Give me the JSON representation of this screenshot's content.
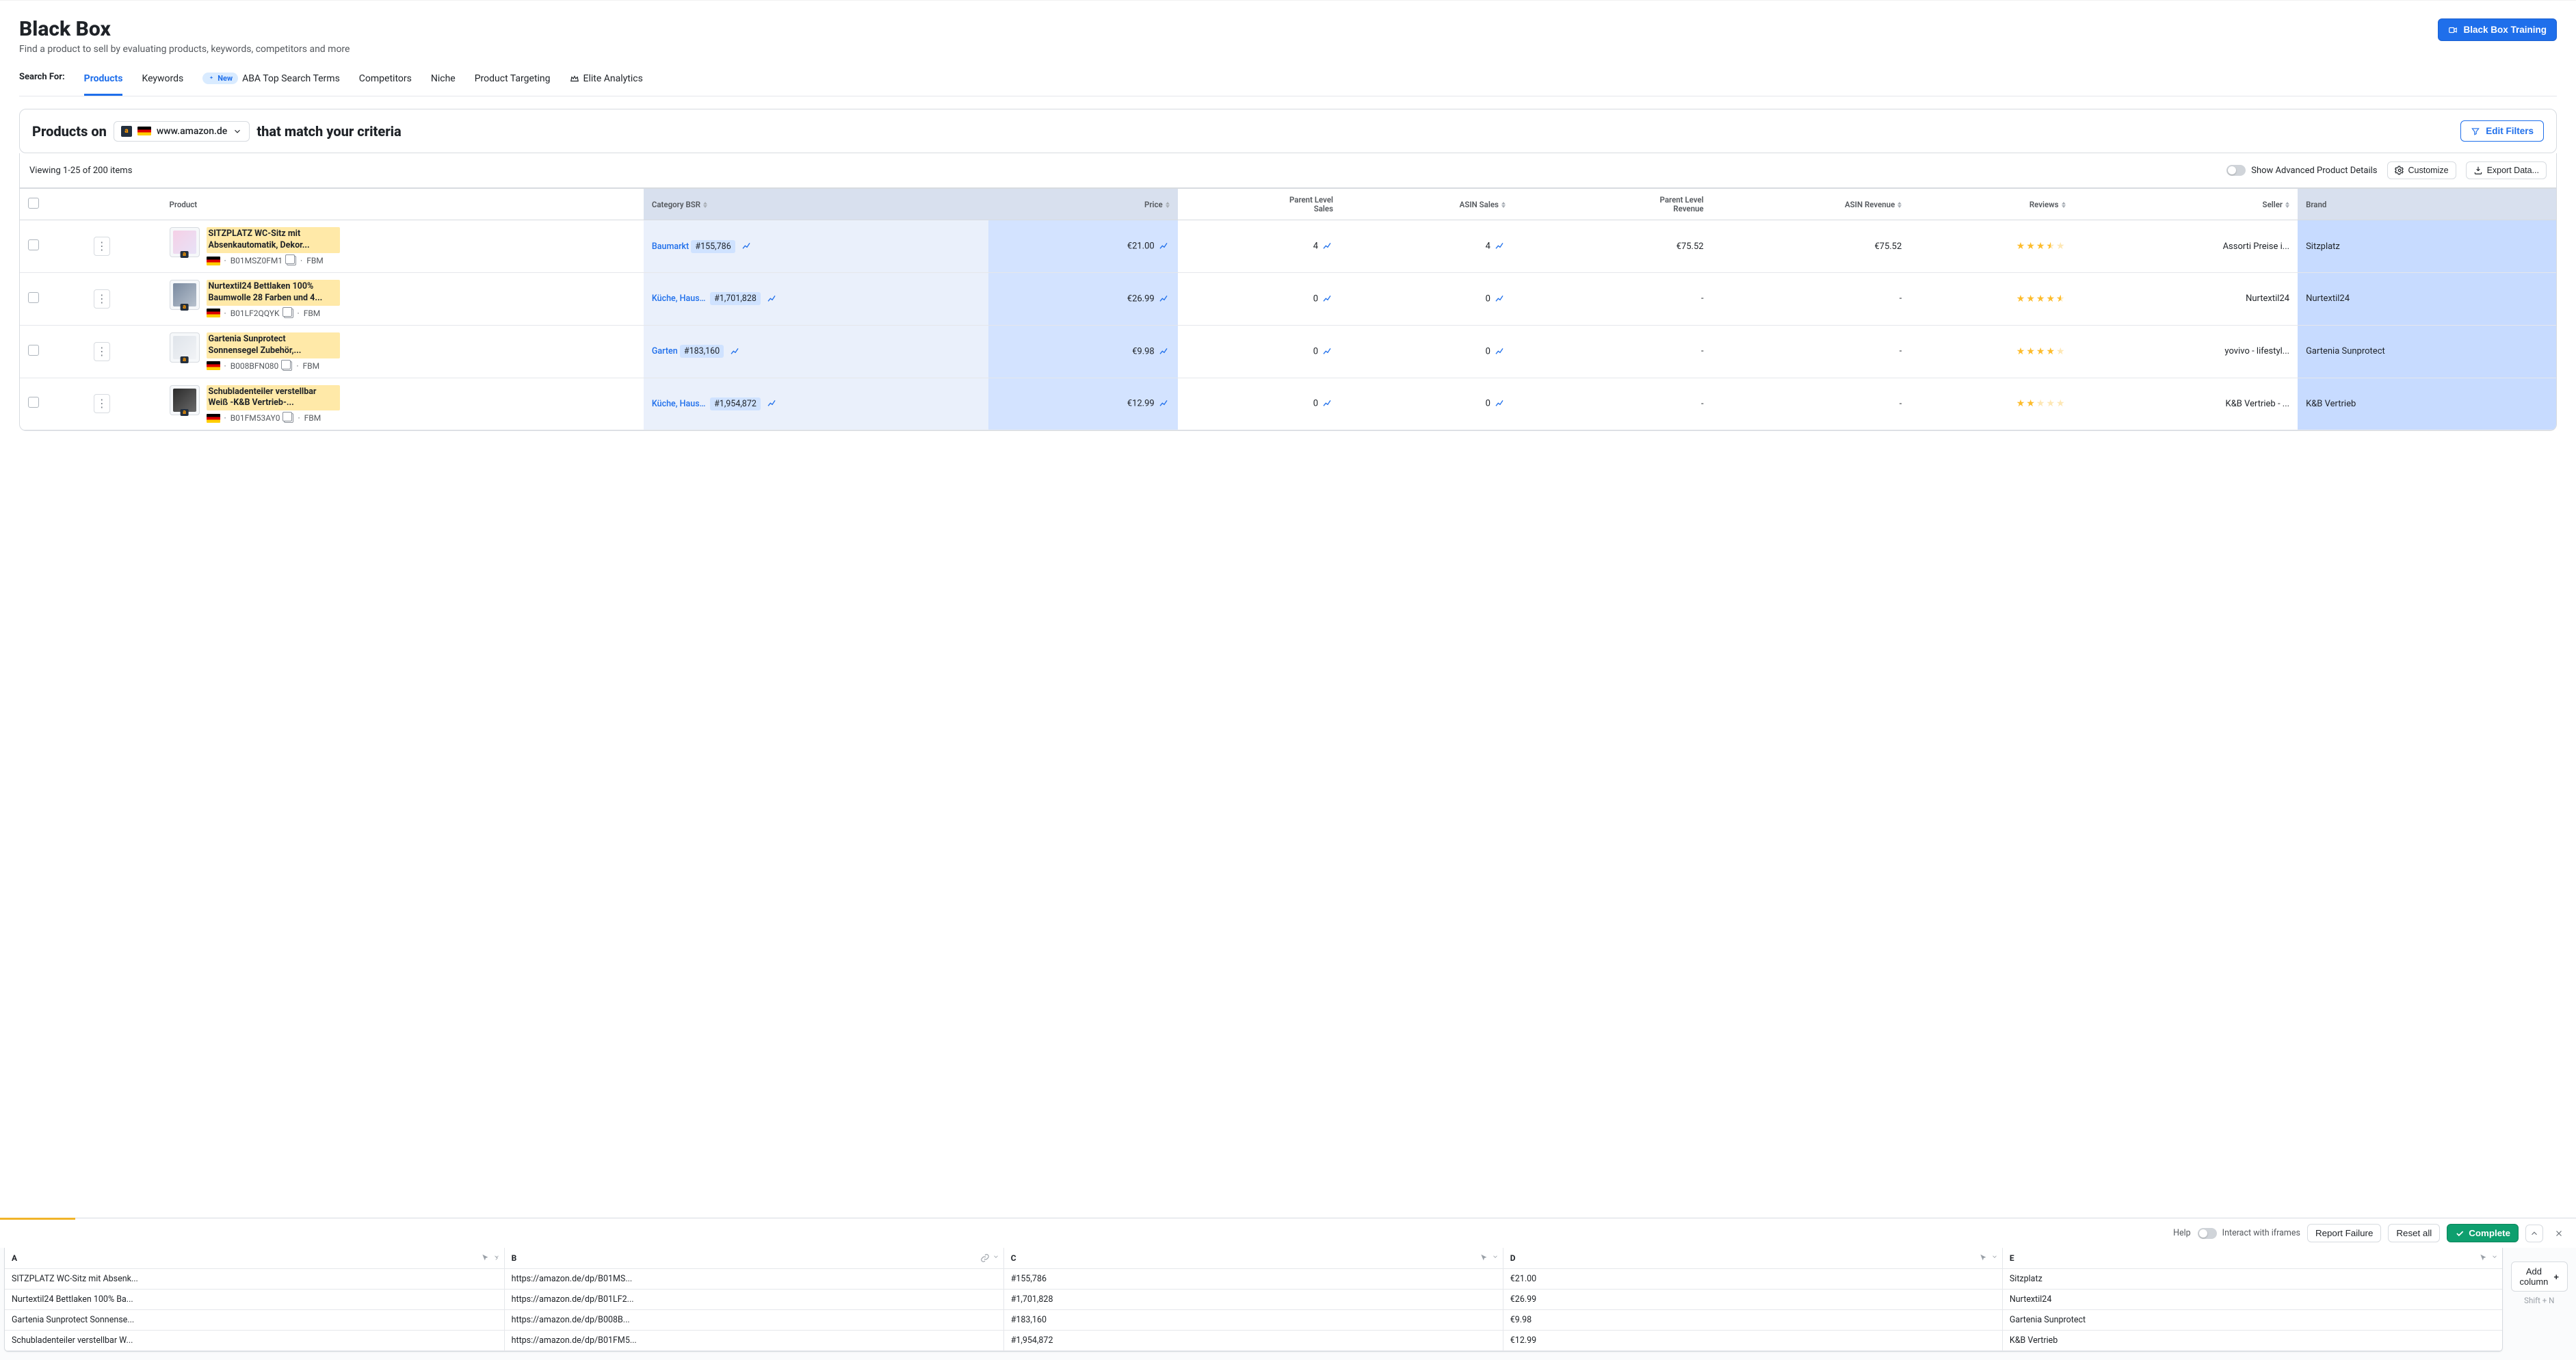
{
  "header": {
    "title": "Black Box",
    "subtitle": "Find a product to sell by evaluating products, keywords, competitors and more",
    "training_button": "Black Box Training"
  },
  "tabs": {
    "label": "Search For:",
    "items": [
      {
        "label": "Products",
        "active": true
      },
      {
        "label": "Keywords"
      },
      {
        "label": "ABA Top Search Terms",
        "new": true,
        "new_label": "New"
      },
      {
        "label": "Competitors"
      },
      {
        "label": "Niche"
      },
      {
        "label": "Product Targeting"
      },
      {
        "label": "Elite Analytics",
        "crown": true
      }
    ]
  },
  "criteria": {
    "prefix": "Products on",
    "market_domain": "www.amazon.de",
    "suffix": "that match your criteria",
    "edit_filters": "Edit Filters"
  },
  "results_bar": {
    "viewing": "Viewing 1-25 of 200 items",
    "advanced_toggle": "Show Advanced Product Details",
    "customize": "Customize",
    "export": "Export Data..."
  },
  "columns": {
    "product": "Product",
    "category_bsr": "Category BSR",
    "price": "Price",
    "parent_sales_l1": "Parent Level",
    "parent_sales_l2": "Sales",
    "asin_sales": "ASIN Sales",
    "parent_rev_l1": "Parent Level",
    "parent_rev_l2": "Revenue",
    "asin_revenue": "ASIN Revenue",
    "reviews": "Reviews",
    "seller": "Seller",
    "brand": "Brand"
  },
  "rows": [
    {
      "thumb": "linear-gradient(135deg,#f5d0e6,#e8e2f7)",
      "title": "SITZPLATZ WC-Sitz mit Absenkautomatik, Dekor...",
      "asin": "B01MSZ0FM1",
      "fulfillment": "FBM",
      "category": "Baumarkt",
      "bsr": "#155,786",
      "price": "€21.00",
      "parent_sales": "4",
      "asin_sales": "4",
      "parent_revenue": "€75.52",
      "asin_revenue": "€75.52",
      "stars": 3.5,
      "seller": "Assorti Preise i...",
      "brand": "Sitzplatz"
    },
    {
      "thumb": "linear-gradient(135deg,#7a8aa0,#b7c1cd)",
      "title": "Nurtextil24 Bettlaken 100% Baumwolle 28 Farben und 4...",
      "asin": "B01LF2QQYK",
      "fulfillment": "FBM",
      "category": "Küche, Hausha...",
      "bsr": "#1,701,828",
      "price": "€26.99",
      "parent_sales": "0",
      "asin_sales": "0",
      "parent_revenue": "-",
      "asin_revenue": "-",
      "stars": 4.5,
      "seller": "Nurtextil24",
      "brand": "Nurtextil24"
    },
    {
      "thumb": "linear-gradient(135deg,#dfe4ea,#f1f3f6)",
      "title": "Gartenia Sunprotect Sonnensegel Zubehör,...",
      "asin": "B008BFN080",
      "fulfillment": "FBM",
      "category": "Garten",
      "bsr": "#183,160",
      "price": "€9.98",
      "parent_sales": "0",
      "asin_sales": "0",
      "parent_revenue": "-",
      "asin_revenue": "-",
      "stars": 4,
      "seller": "yovivo - lifestyl...",
      "brand": "Gartenia Sunprotect"
    },
    {
      "thumb": "linear-gradient(135deg,#2b2b2b,#6a6a6a)",
      "title": "Schubladenteiler verstellbar Weiß -K&B Vertrieb-...",
      "asin": "B01FM53AY0",
      "fulfillment": "FBM",
      "category": "Küche, Hausha...",
      "bsr": "#1,954,872",
      "price": "€12.99",
      "parent_sales": "0",
      "asin_sales": "0",
      "parent_revenue": "-",
      "asin_revenue": "-",
      "stars": 2,
      "seller": "K&B Vertrieb - ...",
      "brand": "K&B Vertrieb"
    }
  ],
  "devbar": {
    "help": "Help",
    "iframes": "Interact with iframes",
    "report": "Report Failure",
    "reset": "Reset all",
    "complete": "Complete"
  },
  "sheet": {
    "headers": [
      "A",
      "B",
      "C",
      "D",
      "E"
    ],
    "rows": [
      {
        "A": "SITZPLATZ WC-Sitz mit Absenk...",
        "B": "https://amazon.de/dp/B01MS...",
        "C": "#155,786",
        "D": "€21.00",
        "E": "Sitzplatz"
      },
      {
        "A": "Nurtextil24 Bettlaken 100% Ba...",
        "B": "https://amazon.de/dp/B01LF2...",
        "C": "#1,701,828",
        "D": "€26.99",
        "E": "Nurtextil24"
      },
      {
        "A": "Gartenia Sunprotect Sonnense...",
        "B": "https://amazon.de/dp/B008B...",
        "C": "#183,160",
        "D": "€9.98",
        "E": "Gartenia Sunprotect"
      },
      {
        "A": "Schubladenteiler verstellbar W...",
        "B": "https://amazon.de/dp/B01FM5...",
        "C": "#1,954,872",
        "D": "€12.99",
        "E": "K&B Vertrieb"
      }
    ],
    "add_column": "Add column",
    "shortcut": "Shift + N"
  }
}
